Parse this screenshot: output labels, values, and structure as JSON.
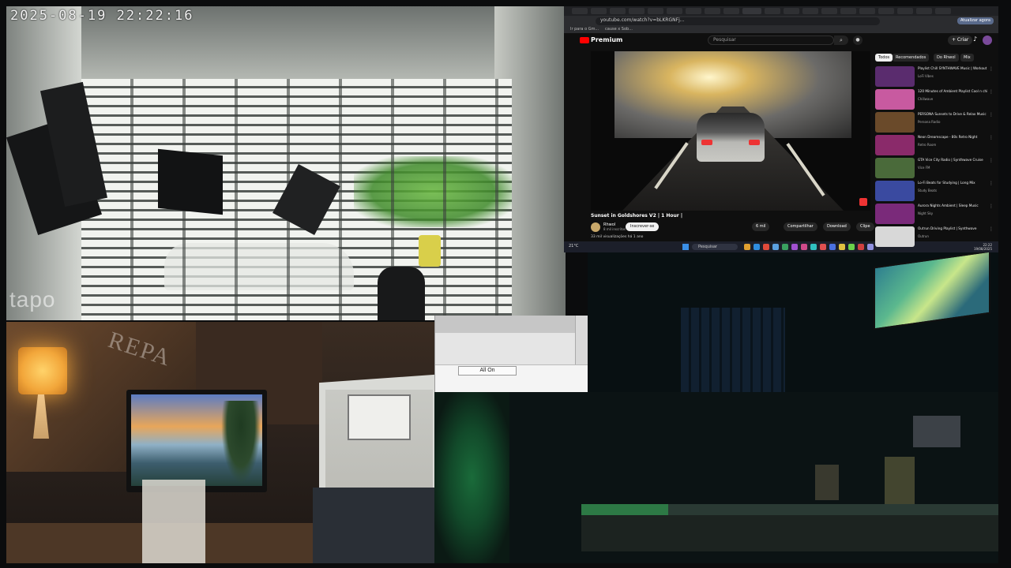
{
  "camera": {
    "timestamp": "2025-08-19  22:22:16",
    "brand": "tapo"
  },
  "browser": {
    "url": "youtube.com/watch?v=bLKRGNFj...",
    "bookmarks": [
      "Ir para o Gm...",
      "cause x Sob..."
    ],
    "profile_label": "Atualizar agora",
    "youtube": {
      "logo_text": "Premium",
      "search_placeholder": "Pesquisar",
      "create_label": "+ Criar",
      "video_title": "Sunset in Goldshores V2 | 1 Hour |",
      "channel_name": "Rhwol",
      "channel_subs": "8 mil inscritos",
      "join_label": "Inscrever-se",
      "likes": "6 mil",
      "share_label": "Compartilhar",
      "download_label": "Download",
      "clip_label": "Clipe",
      "description": "33 mil visualizações  há 1 ano",
      "chips": [
        "Todos",
        "Recomendados",
        "Do Rhwol",
        "Mix"
      ],
      "recommendations": [
        {
          "title": "Playlist Chill SYNTHWAVE Music | Workout Drive",
          "channel": "LoFi Vibes",
          "color": "#5a2c6e"
        },
        {
          "title": "120 Minutes of Ambient Playlist Cool n chillwave",
          "channel": "Chillwave",
          "color": "#c85aa0"
        },
        {
          "title": "PERSONA Sunsets to Drive & Relax Music",
          "channel": "Persona Radio",
          "color": "#6a4a2a"
        },
        {
          "title": "Neon Dreamscape - 80s Retro Night",
          "channel": "Retro Room",
          "color": "#8a2a6a"
        },
        {
          "title": "GTA Vice City Radio | Synthwave Cruise",
          "channel": "Vice FM",
          "color": "#4a6a3a"
        },
        {
          "title": "Lo-Fi Beats for Studying | Long Mix",
          "channel": "Study Beats",
          "color": "#3a4aa0"
        },
        {
          "title": "Aurora Nights Ambient | Sleep Music",
          "channel": "Night Sky",
          "color": "#7a2a7a"
        },
        {
          "title": "Outrun Driving Playlist | Synthwave",
          "channel": "Outrun",
          "color": "#d8d8d8"
        }
      ]
    },
    "taskbar": {
      "weather": "21°C",
      "search_placeholder": "Pesquisar",
      "time": "22:22",
      "date": "19/08/2025"
    }
  },
  "dialog": {
    "button_label": "All On"
  },
  "room_left": {
    "graffiti": "REPA"
  }
}
